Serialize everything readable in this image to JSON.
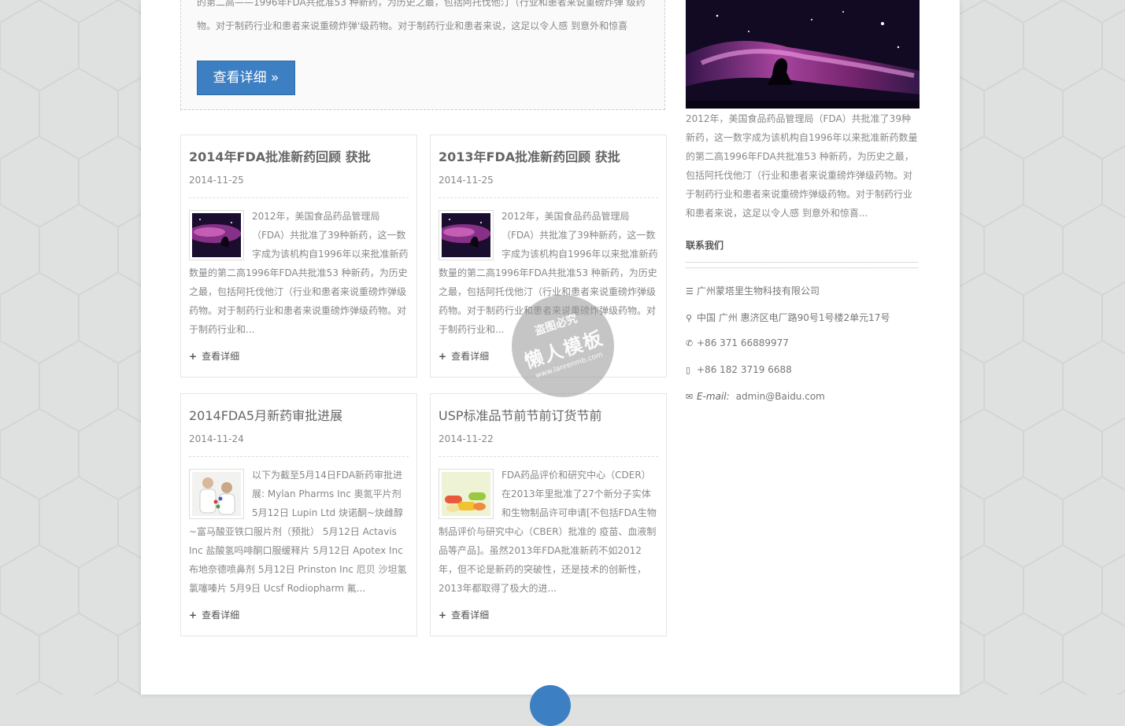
{
  "featured": {
    "text_line1": "的第二高——1996年FDA共批准53 种新药，为历史之最，包括阿托伐他汀（行业和患者来说重磅炸弹 级药",
    "text_line2": "物。对于制药行业和患者来说重磅炸弹'级药物。对于制药行业和患者来说，这足以令人感 到意外和惊喜",
    "button_label": "查看详细 »"
  },
  "cards": [
    {
      "title": "2014年FDA批准新药回顾 获批",
      "date": "2014-11-25",
      "excerpt": "2012年，美国食品药品管理局（FDA）共批准了39种新药，这一数字成为该机构自1996年以来批准新药数量的第二高1996年FDA共批准53 种新药，为历史之最，包括阿托伐他汀（行业和患者来说重磅炸弹级药物。对于制药行业和患者来说重磅炸弹级药物。对于制药行业和...",
      "thumb_icon": "nebula-image",
      "more_label": "查看详细"
    },
    {
      "title": "2013年FDA批准新药回顾 获批",
      "date": "2014-11-25",
      "excerpt": "2012年，美国食品药品管理局（FDA）共批准了39种新药，这一数字成为该机构自1996年以来批准新药数量的第二高1996年FDA共批准53 种新药，为历史之最，包括阿托伐他汀（行业和患者来说重磅炸弹级药物。对于制药行业和患者来说重磅炸弹级药物。对于制药行业和...",
      "thumb_icon": "nebula-image",
      "more_label": "查看详细"
    },
    {
      "title": "2014FDA5月新药审批进展",
      "date": "2014-11-24",
      "excerpt": "以下为截至5月14日FDA新药审批进展: Mylan Pharms Inc 奥氮平片剂 5月12日 Lupin Ltd 炔诺酮~炔雌醇~富马酸亚铁口服片剂（预批） 5月12日 Actavis Inc 盐酸氢吗啡酮口服缓释片 5月12日 Apotex Inc 布地奈德喷鼻剂 5月12日 Prinston Inc 厄贝 沙坦氢氯噻嗪片 5月9日 Ucsf Rodiopharm 氟...",
      "thumb_icon": "scientists-image",
      "more_label": "查看详细"
    },
    {
      "title": "USP标准品节前节前订货节前",
      "date": "2014-11-22",
      "excerpt": "FDA药品评价和研究中心（CDER）在2013年里批准了27个新分子实体和生物制品许可申请[不包括FDA生物制品评价与研究中心（CBER）批准的 疫苗、血液制品等产品]。虽然2013年FDA批准新药不如2012年，但不论是新药的突破性，还是技术的创新性，2013年都取得了极大的进...",
      "thumb_icon": "pills-image",
      "more_label": "查看详细"
    }
  ],
  "sidebar": {
    "image_icon": "nebula-image",
    "text": "2012年，美国食品药品管理局（FDA）共批准了39种新药，这一数字成为该机构自1996年以来批准新药数量的第二高1996年FDA共批准53 种新药，为历史之最，包括阿托伐他汀（行业和患者来说重磅炸弹级药物。对于制药行业和患者来说重磅炸弹级药物。对于制药行业和患者来说，这足以令人感 到意外和惊喜...",
    "contact_title": "联系我们",
    "company": "广州蒙塔里生物科技有限公司",
    "address": "中国 广州 惠济区电厂路90号1号楼2单元17号",
    "phone": "+86 371 66889977",
    "mobile": "+86 182 3719 6688",
    "email_label": "E-mail:",
    "email": "admin@Baidu.com"
  },
  "watermark": {
    "line1": "盗图必究",
    "line2": "懒人模板",
    "line3": "www.lanrenmb.com"
  },
  "colors": {
    "accent": "#3d7fc3",
    "page_bg": "#dfe0e0"
  }
}
